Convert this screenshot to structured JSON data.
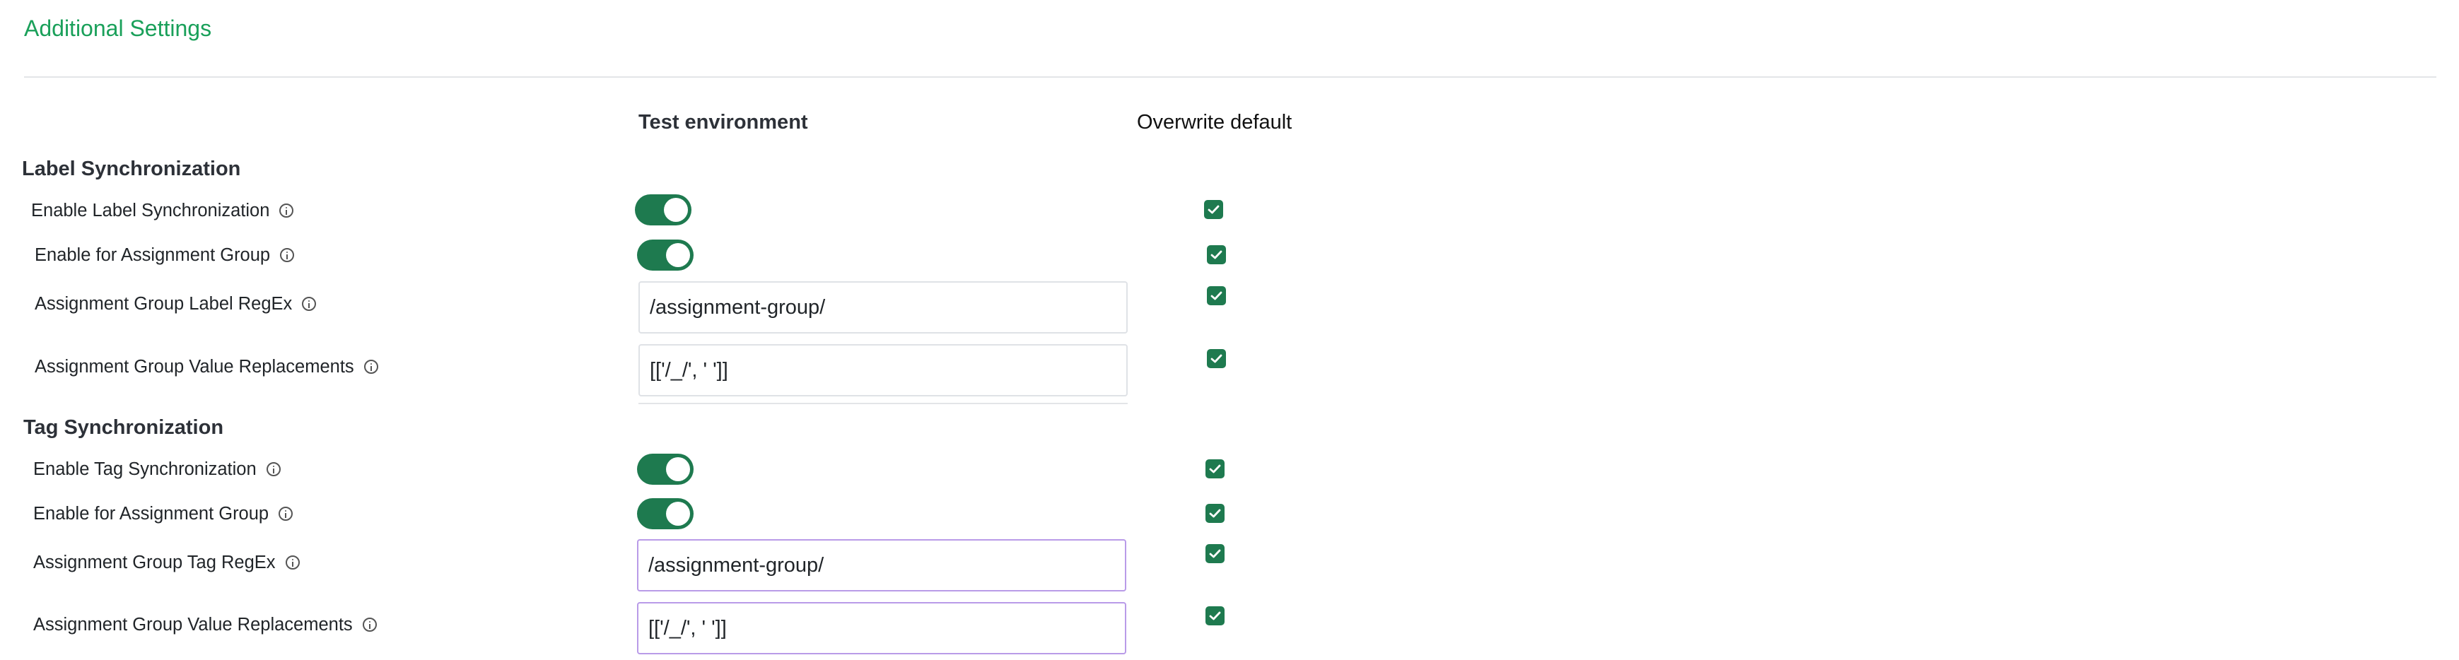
{
  "page": {
    "title": "Additional Settings"
  },
  "columns": {
    "test_environment": "Test environment",
    "overwrite_default": "Overwrite default"
  },
  "label_sync": {
    "title": "Label Synchronization",
    "rows": [
      {
        "label": "Enable Label Synchronization",
        "type": "toggle",
        "on": true,
        "overwrite": true
      },
      {
        "label": "Enable for Assignment Group",
        "type": "toggle",
        "on": true,
        "overwrite": true
      },
      {
        "label": "Assignment Group Label RegEx",
        "type": "text",
        "value": "/assignment-group/",
        "overwrite": true
      },
      {
        "label": "Assignment Group Value Replacements",
        "type": "text",
        "value": "[['/_/', ' ']]",
        "overwrite": true
      }
    ]
  },
  "tag_sync": {
    "title": "Tag Synchronization",
    "rows": [
      {
        "label": "Enable Tag Synchronization",
        "type": "toggle",
        "on": true,
        "overwrite": true
      },
      {
        "label": "Enable for Assignment Group",
        "type": "toggle",
        "on": true,
        "overwrite": true
      },
      {
        "label": "Assignment Group Tag RegEx",
        "type": "text",
        "value": "/assignment-group/",
        "overwrite": true
      },
      {
        "label": "Assignment Group Value Replacements",
        "type": "text",
        "value": "[['/_/', ' ']]",
        "overwrite": true
      }
    ]
  },
  "icons": {
    "info": "info-circle-icon",
    "check": "check-icon"
  },
  "colors": {
    "title_green": "#1aa05a",
    "toggle_on": "#1e7a4f",
    "checkbox_checked": "#1e7a4f",
    "focus_border": "#b99be8"
  }
}
